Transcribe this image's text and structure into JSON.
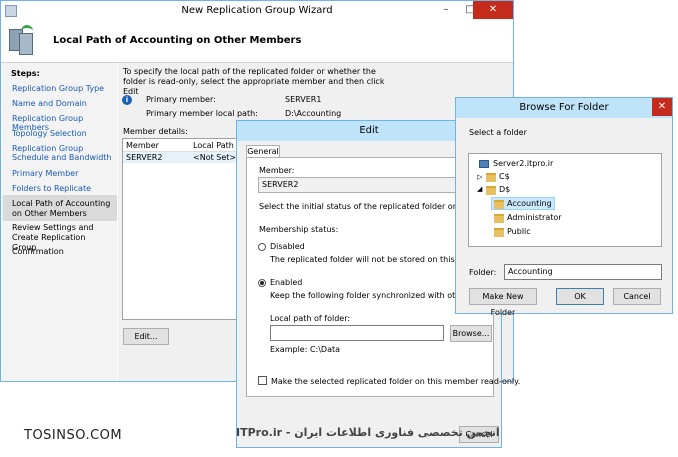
{
  "wizard": {
    "title": "New Replication Group Wizard",
    "header": "Local Path of Accounting on Other Members",
    "steps_label": "Steps:",
    "steps": [
      "Replication Group Type",
      "Name and Domain",
      "Replication Group Members",
      "Topology Selection",
      "Replication Group Schedule and Bandwidth",
      "Primary Member",
      "Folders to Replicate",
      "Local Path of Accounting on Other Members",
      "Review Settings and Create Replication Group",
      "Confirmation"
    ],
    "description": "To specify the local path of the replicated folder or whether the folder is read-only, select the appropriate member and then click Edit",
    "primary_member_label": "Primary member:",
    "primary_member_value": "SERVER1",
    "local_path_label": "Primary member local path:",
    "local_path_value": "D:\\Accounting",
    "member_details_label": "Member details:",
    "columns": [
      "Member",
      "Local Path"
    ],
    "rows": [
      [
        "SERVER2",
        "<Not Set>"
      ]
    ],
    "edit_button": "Edit..."
  },
  "edit": {
    "title": "Edit",
    "tab": "General",
    "member_label": "Member:",
    "member_value": "SERVER2",
    "status_text": "Select the initial status of the replicated folder on this member.",
    "membership_label": "Membership status:",
    "disabled_label": "Disabled",
    "disabled_desc": "The replicated folder will not be stored on this member.",
    "enabled_label": "Enabled",
    "enabled_desc": "Keep the following folder synchronized with other members.",
    "local_path_label": "Local path of folder:",
    "browse_button": "Browse...",
    "example": "Example: C:\\Data",
    "readonly_label": "Make the selected replicated folder on this member read-only.",
    "cancel_button": "Cancel"
  },
  "browse": {
    "title": "Browse For Folder",
    "prompt": "Select a folder",
    "tree": {
      "root": "Server2.itpro.ir",
      "c": "C$",
      "d": "D$",
      "children": [
        "Accounting",
        "Administrator",
        "Public"
      ]
    },
    "folder_label": "Folder:",
    "folder_value": "Accounting",
    "make_new_folder": "Make New Folder",
    "ok": "OK",
    "cancel": "Cancel"
  },
  "watermark": {
    "left": "TOSINSO.COM",
    "right": "انجمن تخصصی فناوری اطلاعات ایران - ITPro.ir"
  },
  "colors": {
    "accent": "#6fb4e6",
    "link": "#1a5bb5",
    "selection": "#cce8ff",
    "close": "#c42b1c"
  }
}
